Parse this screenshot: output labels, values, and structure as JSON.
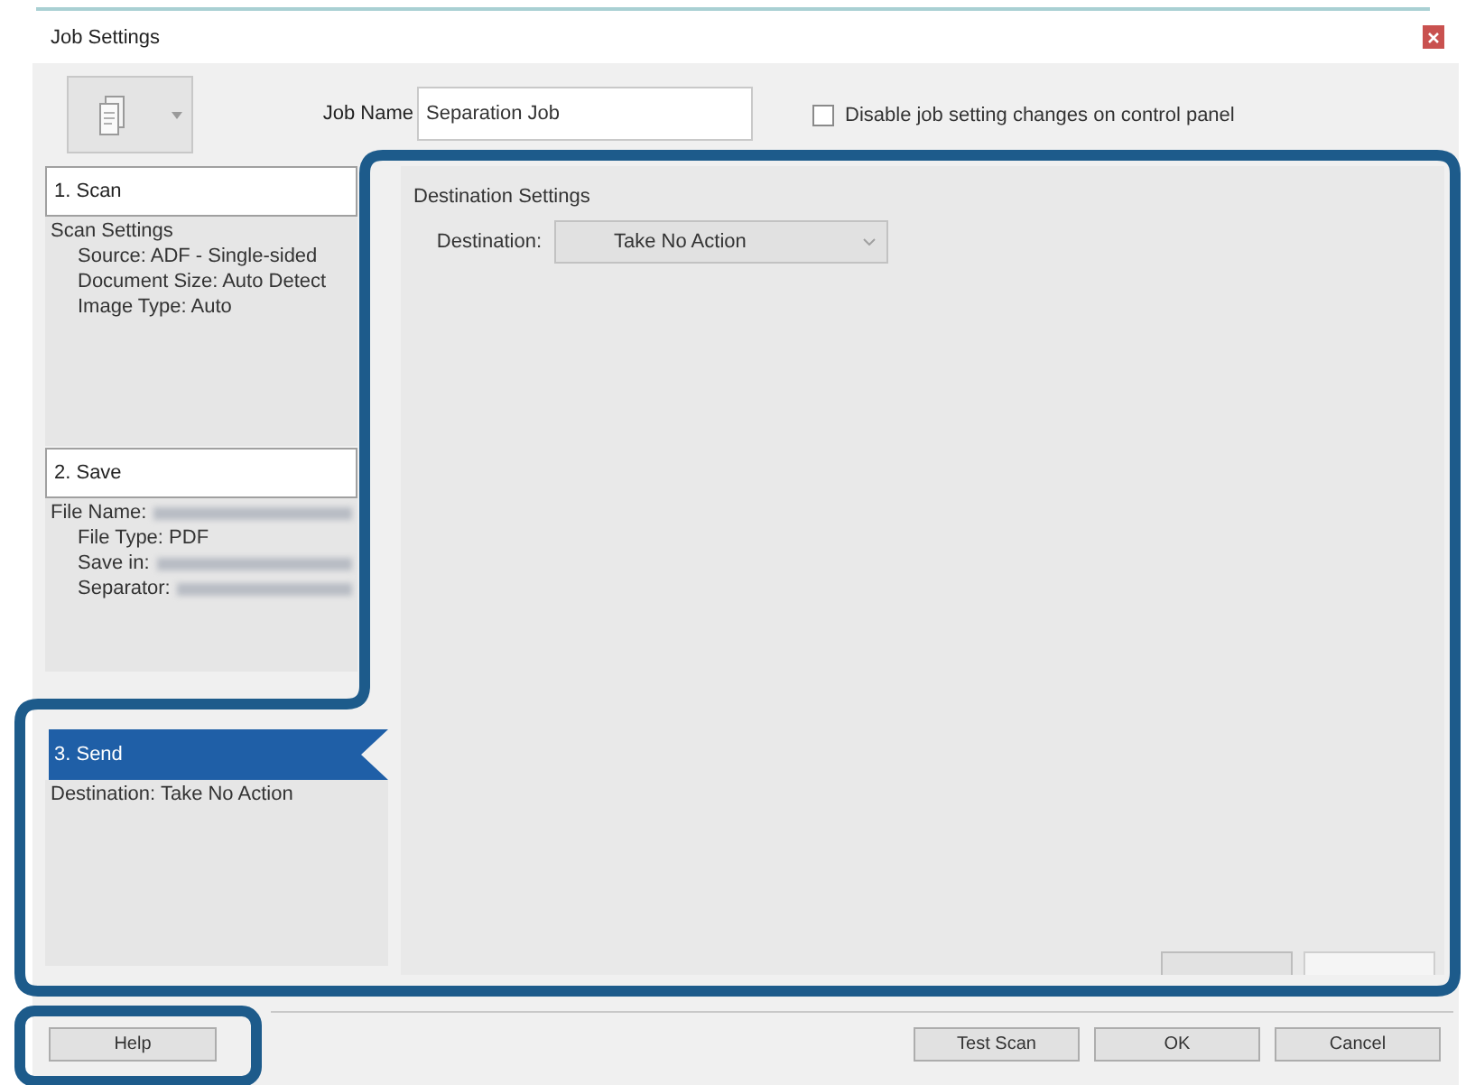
{
  "window": {
    "title": "Job Settings"
  },
  "toolbar": {
    "job_name": {
      "label": "Job Name",
      "value": "Separation Job"
    },
    "lock_option": {
      "label": "Disable job setting changes on control panel",
      "checked": false
    }
  },
  "steps": [
    {
      "label": "1. Scan",
      "selected": false,
      "details": [
        {
          "text": "Scan Settings",
          "redacted": false,
          "children": [
            {
              "text": "Source: ADF - Single-sided",
              "redacted": false
            },
            {
              "text": "Document Size: Auto Detect",
              "redacted": false
            },
            {
              "text": "Image Type: Auto",
              "redacted": false
            }
          ]
        }
      ]
    },
    {
      "label": "2. Save",
      "selected": false,
      "details": [
        {
          "text": "File Name:",
          "redacted": true,
          "children": [
            {
              "text": "File Type: PDF",
              "redacted": false
            },
            {
              "text": "Save in:",
              "redacted": true
            },
            {
              "text": "Separator:",
              "redacted": true
            }
          ]
        }
      ]
    },
    {
      "label": "3. Send",
      "selected": true,
      "details": [
        {
          "text": "Destination: Take No Action",
          "redacted": false
        }
      ]
    }
  ],
  "destination_settings": {
    "title": "Destination Settings",
    "destination": {
      "label": "Destination:",
      "value": "Take No Action"
    }
  },
  "footer": {
    "help_button": "Help",
    "buttons": [
      "Test Scan",
      "OK",
      "Cancel"
    ]
  }
}
